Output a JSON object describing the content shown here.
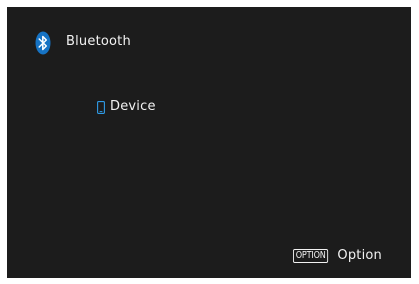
{
  "header": {
    "icon": "bluetooth-icon",
    "title": "Bluetooth"
  },
  "device": {
    "icon": "phone-icon",
    "label": "Device"
  },
  "option": {
    "key_label": "OPTION",
    "label": "Option"
  },
  "colors": {
    "background": "#1c1c1c",
    "text": "#f2f2f2",
    "bluetooth_badge": "#1673c4"
  }
}
